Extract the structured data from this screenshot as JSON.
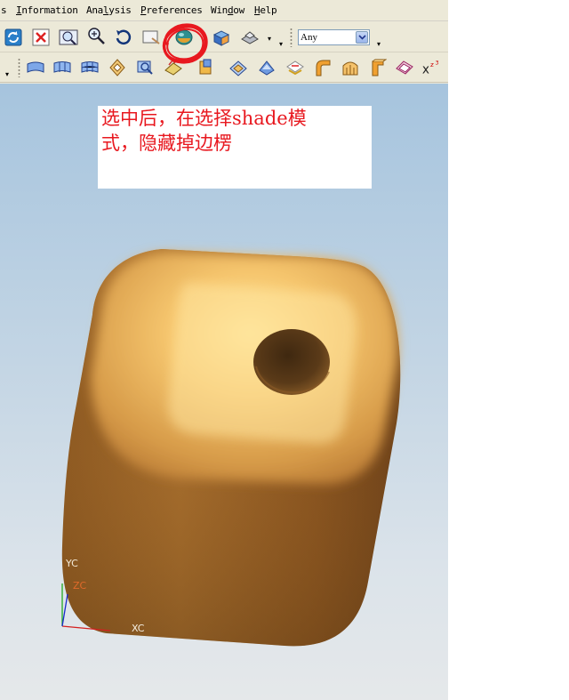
{
  "menubar": {
    "items": [
      {
        "label": "s"
      },
      {
        "label": "Information"
      },
      {
        "label": "Analysis"
      },
      {
        "label": "Preferences"
      },
      {
        "label": "Window"
      },
      {
        "label": "Help"
      }
    ]
  },
  "toolbar1": {
    "buttons": [
      "refresh-icon",
      "fit-icon",
      "zoom-window-icon",
      "zoom-icon",
      "rotate-icon",
      "pan-icon",
      "shaded-style-icon",
      "perspective-icon",
      "layer-icon"
    ],
    "filter": {
      "value": "Any"
    }
  },
  "toolbar2": {
    "buttons": [
      "ruled-surface-icon",
      "through-curves-icon",
      "through-curve-mesh-icon",
      "swept-icon",
      "section-icon",
      "bounded-plane-icon",
      "extension-icon",
      "offset-surface-icon",
      "trim-icon",
      "sew-icon",
      "blend-icon",
      "face-blend-icon",
      "styled-blend-icon",
      "thicken-icon",
      "law-icon",
      "expression-icon"
    ],
    "expression_label": "x"
  },
  "viewport": {
    "annotation": {
      "text": "选中后，在选择shade模\n式，隐藏掉边楞"
    },
    "triad": {
      "yc": "YC",
      "zc": "ZC",
      "xc": "XC"
    }
  },
  "colors": {
    "ui_background": "#ece9d8",
    "annotation_text": "#e8181f",
    "highlight_circle": "#e8181f",
    "model_base": "#b07a34",
    "model_highlight": "#ffe08a"
  }
}
